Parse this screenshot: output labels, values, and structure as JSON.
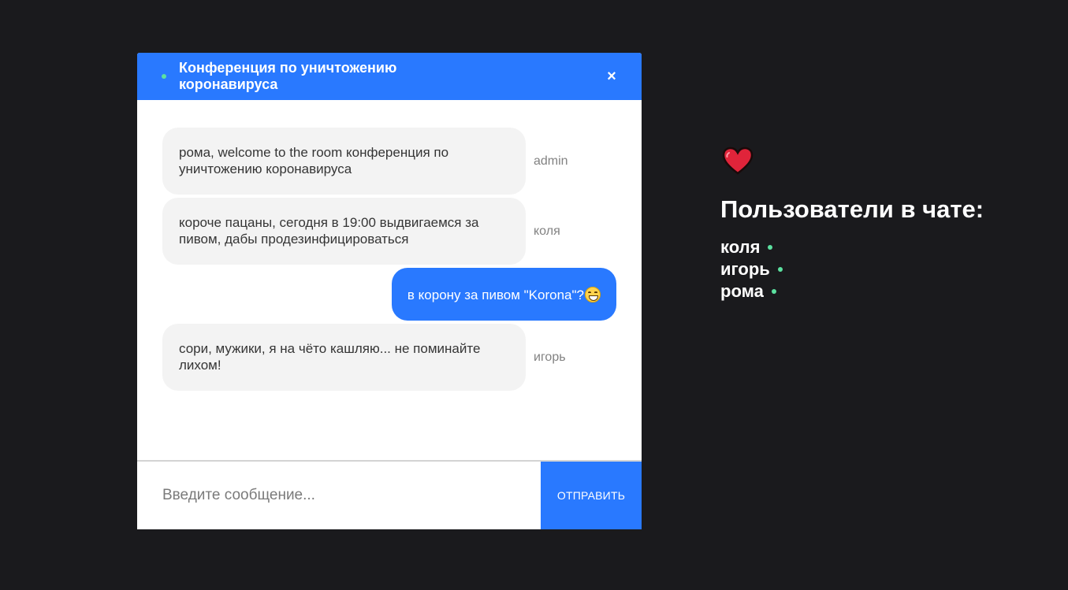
{
  "chat": {
    "room_title": "Конференция по уничтожению коронавируса",
    "close_label": "×",
    "messages": [
      {
        "text": "рома, welcome to the room конференция по уничтожению коронавируса",
        "sender": "admin",
        "own": false
      },
      {
        "text": "короче пацаны, сегодня в 19:00 выдвигаемся за пивом, дабы продезинфицироваться",
        "sender": "коля",
        "own": false
      },
      {
        "text": "в корону за пивом \"Korona\"?",
        "sender": "",
        "own": true,
        "emoji": "grinning-face-icon"
      },
      {
        "text": "сори, мужики, я на чёто кашляю... не поминайте лихом!",
        "sender": "игорь",
        "own": false
      }
    ],
    "input_placeholder": "Введите сообщение...",
    "input_value": "",
    "send_label": "Отправить"
  },
  "sidebar": {
    "icon": "heart-icon",
    "title": "Пользователи в чате:",
    "users": [
      "коля",
      "игорь",
      "рома"
    ]
  },
  "colors": {
    "accent": "#2979ff",
    "online": "#5ce1a0",
    "background": "#1a1a1d",
    "bubble": "#f3f3f3"
  }
}
